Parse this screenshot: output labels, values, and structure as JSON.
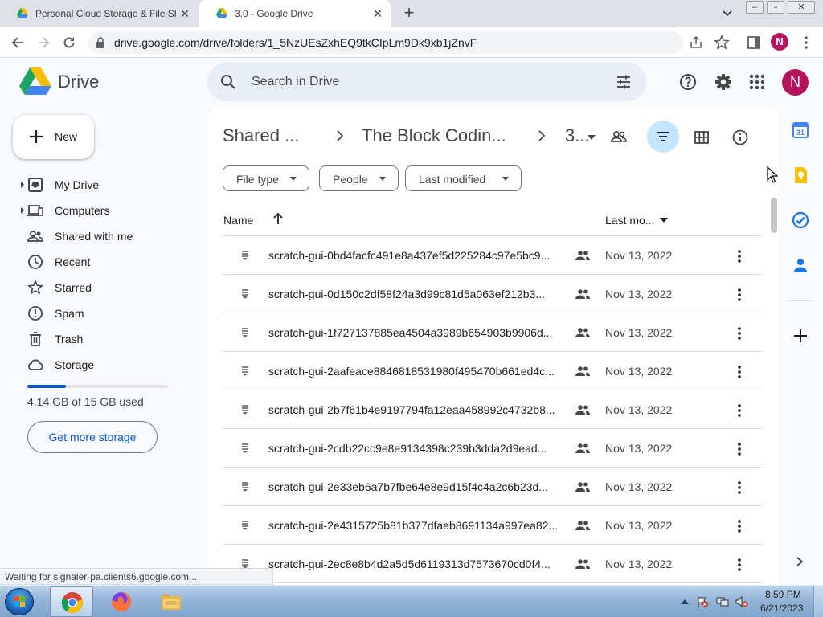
{
  "browser": {
    "tabs": [
      {
        "title": "Personal Cloud Storage & File Sh",
        "active": false
      },
      {
        "title": "3.0 - Google Drive",
        "active": true
      }
    ],
    "url": "drive.google.com/drive/folders/1_5NzUEsZxhEQ9tkCIpLm9Dk9xb1jZnvF",
    "profile_initial": "N"
  },
  "drive": {
    "app_name": "Drive",
    "search_placeholder": "Search in Drive",
    "avatar_initial": "N",
    "new_label": "New",
    "nav": [
      {
        "label": "My Drive",
        "icon": "my-drive-icon",
        "expandable": true
      },
      {
        "label": "Computers",
        "icon": "computers-icon",
        "expandable": true
      },
      {
        "label": "Shared with me",
        "icon": "shared-with-me-icon",
        "expandable": false
      },
      {
        "label": "Recent",
        "icon": "recent-icon",
        "expandable": false
      },
      {
        "label": "Starred",
        "icon": "star-icon",
        "expandable": false
      },
      {
        "label": "Spam",
        "icon": "spam-icon",
        "expandable": false
      },
      {
        "label": "Trash",
        "icon": "trash-icon",
        "expandable": false
      },
      {
        "label": "Storage",
        "icon": "cloud-icon",
        "expandable": false
      }
    ],
    "storage": {
      "used_text": "4.14 GB of 15 GB used",
      "fraction": 0.276,
      "button": "Get more storage"
    },
    "breadcrumb": [
      "Shared ...",
      "The Block Codin...",
      "3..."
    ],
    "filters": [
      "File type",
      "People",
      "Last modified"
    ],
    "columns": {
      "name": "Name",
      "modified": "Last mo..."
    },
    "files": [
      {
        "name": "scratch-gui-0bd4facfc491e8a437ef5d225284c97e5bc9...",
        "date": "Nov 13, 2022"
      },
      {
        "name": "scratch-gui-0d150c2df58f24a3d99c81d5a063ef212b3...",
        "date": "Nov 13, 2022"
      },
      {
        "name": "scratch-gui-1f727137885ea4504a3989b654903b9906d...",
        "date": "Nov 13, 2022"
      },
      {
        "name": "scratch-gui-2aafeace8846818531980f495470b661ed4c...",
        "date": "Nov 13, 2022"
      },
      {
        "name": "scratch-gui-2b7f61b4e9197794fa12eaa458992c4732b8...",
        "date": "Nov 13, 2022"
      },
      {
        "name": "scratch-gui-2cdb22cc9e8e9134398c239b3dda2d9ead...",
        "date": "Nov 13, 2022"
      },
      {
        "name": "scratch-gui-2e33eb6a7b7fbe64e8e9d15f4c4a2c6b23d...",
        "date": "Nov 13, 2022"
      },
      {
        "name": "scratch-gui-2e4315725b81b377dfaeb8691134a997ea82...",
        "date": "Nov 13, 2022"
      },
      {
        "name": "scratch-gui-2ec8e8b4d2a5d5d6119313d7573670cd0f4...",
        "date": "Nov 13, 2022"
      }
    ]
  },
  "status": "Waiting for signaler-pa.clients6.google.com...",
  "taskbar": {
    "time": "8:59 PM",
    "date": "6/21/2023"
  },
  "colors": {
    "accent": "#0b57d0",
    "avatar": "#b5135b",
    "selected_chip": "#c2e7ff",
    "panel_bg": "#f8fafd"
  }
}
